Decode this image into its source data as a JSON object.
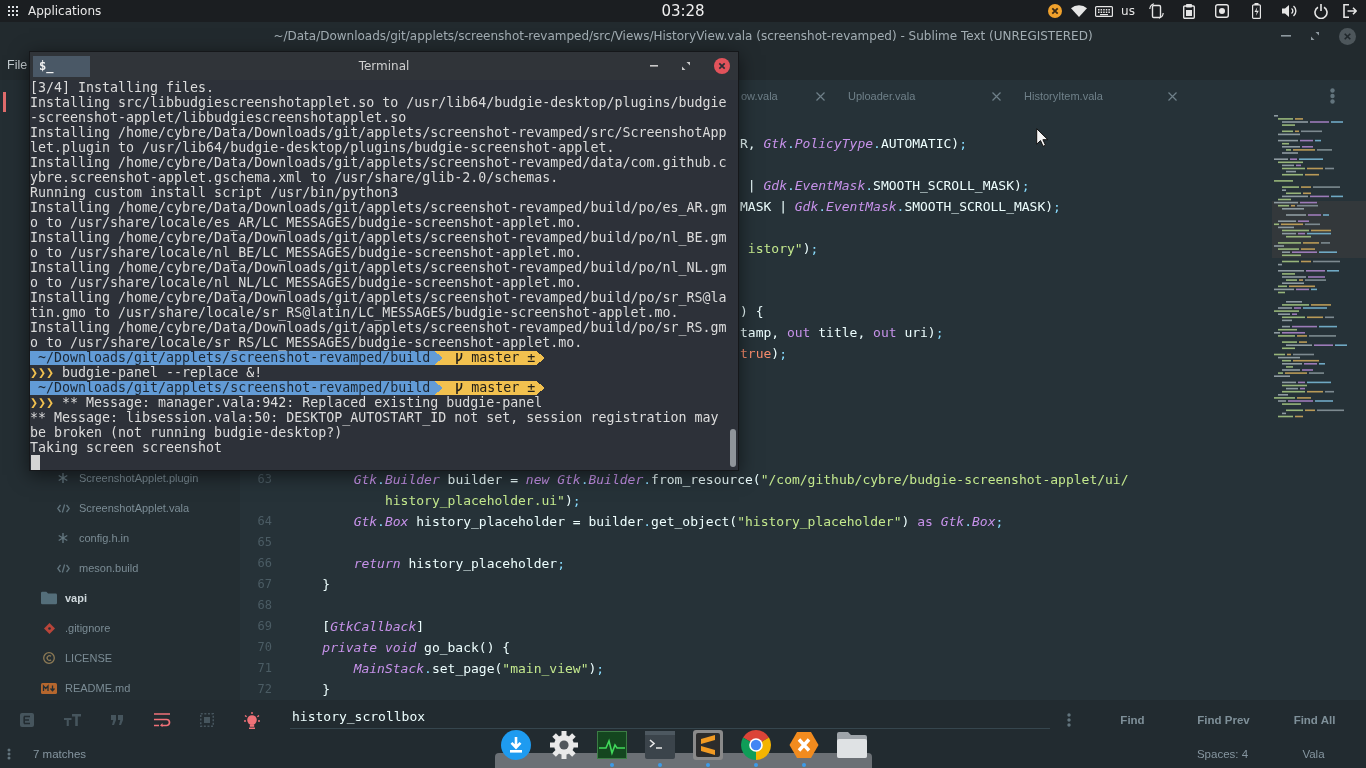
{
  "top_panel": {
    "menu": "Applications",
    "clock": "03:28",
    "keyboard_layout": "us"
  },
  "editor": {
    "title": "~/Data/Downloads/git/applets/screenshot-revamped/src/Views/HistoryView.vala (screenshot-revamped) - Sublime Text (UNREGISTERED)",
    "menu": [
      "File"
    ],
    "tabs": [
      {
        "label": "ow.vala",
        "selected": false
      },
      {
        "label": "Uploader.vala",
        "selected": false
      },
      {
        "label": "HistoryItem.vala",
        "selected": false
      }
    ],
    "sidebar": [
      {
        "children": [
          {
            "name": "ScreenshotApplet.plugin",
            "kind": "config"
          },
          {
            "name": "ScreenshotApplet.vala",
            "kind": "code"
          },
          {
            "name": "config.h.in",
            "kind": "config"
          },
          {
            "name": "meson.build",
            "kind": "code"
          }
        ]
      },
      {
        "name": "vapi",
        "kind": "folder"
      },
      {
        "name": ".gitignore",
        "kind": "git"
      },
      {
        "name": "LICENSE",
        "kind": "license"
      },
      {
        "name": "README.md",
        "kind": "markdown"
      }
    ],
    "fragments": [
      {
        "tokens": [
          {
            "kind": "plain",
            "text": "R, "
          },
          {
            "kind": "type",
            "text": "Gtk"
          },
          {
            "kind": "punct",
            "text": "."
          },
          {
            "kind": "type",
            "text": "PolicyType"
          },
          {
            "kind": "punct",
            "text": "."
          },
          {
            "kind": "plain",
            "text": "AUTOMATIC)"
          },
          {
            "kind": "punct",
            "text": ";"
          }
        ]
      },
      {
        "tokens": [
          {
            "kind": "plain",
            "text": " | "
          },
          {
            "kind": "type",
            "text": "Gdk"
          },
          {
            "kind": "punct",
            "text": "."
          },
          {
            "kind": "type",
            "text": "EventMask"
          },
          {
            "kind": "punct",
            "text": "."
          },
          {
            "kind": "plain",
            "text": "SMOOTH_SCROLL_MASK)"
          },
          {
            "kind": "punct",
            "text": ";"
          }
        ]
      },
      {
        "tokens": [
          {
            "kind": "plain",
            "text": "MASK | "
          },
          {
            "kind": "type",
            "text": "Gdk"
          },
          {
            "kind": "punct",
            "text": "."
          },
          {
            "kind": "type",
            "text": "EventMask"
          },
          {
            "kind": "punct",
            "text": "."
          },
          {
            "kind": "plain",
            "text": "SMOOTH_SCROLL_MASK)"
          },
          {
            "kind": "punct",
            "text": ";"
          }
        ]
      },
      {
        "tokens": [
          {
            "kind": "string",
            "text": " istory\""
          },
          {
            "kind": "plain",
            "text": ")"
          },
          {
            "kind": "punct",
            "text": ";"
          }
        ]
      },
      {
        "tokens": [
          {
            "kind": "plain",
            "text": ") {"
          }
        ]
      },
      {
        "tokens": [
          {
            "kind": "plain",
            "text": "tamp, "
          },
          {
            "kind": "keyword",
            "text": "out"
          },
          {
            "kind": "plain",
            "text": " title, "
          },
          {
            "kind": "keyword",
            "text": "out"
          },
          {
            "kind": "plain",
            "text": " uri)"
          },
          {
            "kind": "punct",
            "text": ";"
          }
        ]
      },
      {
        "tokens": [
          {
            "kind": "constant",
            "text": "true"
          },
          {
            "kind": "plain",
            "text": ")"
          },
          {
            "kind": "punct",
            "text": ";"
          }
        ]
      }
    ],
    "lines": [
      {
        "number": "63",
        "tokens": [
          {
            "kind": "type",
            "text": "        Gtk"
          },
          {
            "kind": "punct",
            "text": "."
          },
          {
            "kind": "type",
            "text": "Builder"
          },
          {
            "kind": "plain",
            "text": " builder = "
          },
          {
            "kind": "storage",
            "text": "new "
          },
          {
            "kind": "type",
            "text": "Gtk"
          },
          {
            "kind": "punct",
            "text": "."
          },
          {
            "kind": "type",
            "text": "Builder"
          },
          {
            "kind": "punct",
            "text": "."
          },
          {
            "kind": "plain",
            "text": "from_resource("
          },
          {
            "kind": "string",
            "text": "\"/com/github/cybre/budgie-screenshot-applet/ui/"
          }
        ],
        "continuation": [
          {
            "kind": "string",
            "text": "            history_placeholder.ui\""
          },
          {
            "kind": "plain",
            "text": ")"
          },
          {
            "kind": "punct",
            "text": ";"
          }
        ]
      },
      {
        "number": "64",
        "tokens": [
          {
            "kind": "type",
            "text": "        Gtk"
          },
          {
            "kind": "punct",
            "text": "."
          },
          {
            "kind": "type",
            "text": "Box"
          },
          {
            "kind": "plain",
            "text": " history_placeholder = builder"
          },
          {
            "kind": "punct",
            "text": "."
          },
          {
            "kind": "plain",
            "text": "get_object("
          },
          {
            "kind": "string",
            "text": "\"history_placeholder\""
          },
          {
            "kind": "plain",
            "text": ") "
          },
          {
            "kind": "keyword",
            "text": "as "
          },
          {
            "kind": "type",
            "text": "Gtk"
          },
          {
            "kind": "punct",
            "text": "."
          },
          {
            "kind": "type",
            "text": "Box"
          },
          {
            "kind": "punct",
            "text": ";"
          }
        ]
      },
      {
        "number": "65"
      },
      {
        "number": "66",
        "tokens": [
          {
            "kind": "storage",
            "text": "        return"
          },
          {
            "kind": "plain",
            "text": " history_placeholder"
          },
          {
            "kind": "punct",
            "text": ";"
          }
        ]
      },
      {
        "number": "67",
        "tokens": [
          {
            "kind": "plain",
            "text": "    }"
          }
        ]
      },
      {
        "number": "68"
      },
      {
        "number": "69",
        "tokens": [
          {
            "kind": "plain",
            "text": "    ["
          },
          {
            "kind": "type",
            "text": "GtkCallback"
          },
          {
            "kind": "plain",
            "text": "]"
          }
        ]
      },
      {
        "number": "70",
        "tokens": [
          {
            "kind": "storage",
            "text": "    private void"
          },
          {
            "kind": "plain",
            "text": " go_back() {"
          }
        ]
      },
      {
        "number": "71",
        "tokens": [
          {
            "kind": "type",
            "text": "        MainStack"
          },
          {
            "kind": "punct",
            "text": "."
          },
          {
            "kind": "plain",
            "text": "set_page("
          },
          {
            "kind": "string",
            "text": "\"main_view\""
          },
          {
            "kind": "plain",
            "text": ")"
          },
          {
            "kind": "punct",
            "text": ";"
          }
        ]
      },
      {
        "number": "72",
        "tokens": [
          {
            "kind": "plain",
            "text": "    }"
          }
        ]
      }
    ],
    "find": {
      "options": [
        {
          "kind": "regex",
          "on": false
        },
        {
          "kind": "case",
          "on": false
        },
        {
          "kind": "word",
          "on": false
        },
        {
          "kind": "wrap",
          "on": true
        },
        {
          "kind": "selection",
          "on": false
        },
        {
          "kind": "highlight",
          "on": true
        }
      ],
      "query": "history_scrollbox",
      "buttons": [
        "Find",
        "Find Prev",
        "Find All"
      ]
    },
    "status_bar": {
      "matches": "7 matches",
      "indentation": "Spaces: 4",
      "syntax": "Vala"
    }
  },
  "terminal": {
    "title": "Terminal",
    "badge": "$_",
    "lines": [
      {
        "kind": "output",
        "text": "[3/4] Installing files."
      },
      {
        "kind": "output",
        "text": "Installing src/libbudgiescreenshotapplet.so to /usr/lib64/budgie-desktop/plugins/budgie"
      },
      {
        "kind": "output",
        "text": "-screenshot-applet/libbudgiescreenshotapplet.so"
      },
      {
        "kind": "output",
        "text": "Installing /home/cybre/Data/Downloads/git/applets/screenshot-revamped/src/ScreenshotApp"
      },
      {
        "kind": "output",
        "text": "let.plugin to /usr/lib64/budgie-desktop/plugins/budgie-screenshot-applet."
      },
      {
        "kind": "output",
        "text": "Installing /home/cybre/Data/Downloads/git/applets/screenshot-revamped/data/com.github.c"
      },
      {
        "kind": "output",
        "text": "ybre.screenshot-applet.gschema.xml to /usr/share/glib-2.0/schemas."
      },
      {
        "kind": "output",
        "text": "Running custom install script /usr/bin/python3"
      },
      {
        "kind": "output",
        "text": "Installing /home/cybre/Data/Downloads/git/applets/screenshot-revamped/build/po/es_AR.gm"
      },
      {
        "kind": "output",
        "text": "o to /usr/share/locale/es_AR/LC_MESSAGES/budgie-screenshot-applet.mo."
      },
      {
        "kind": "output",
        "text": "Installing /home/cybre/Data/Downloads/git/applets/screenshot-revamped/build/po/nl_BE.gm"
      },
      {
        "kind": "output",
        "text": "o to /usr/share/locale/nl_BE/LC_MESSAGES/budgie-screenshot-applet.mo."
      },
      {
        "kind": "output",
        "text": "Installing /home/cybre/Data/Downloads/git/applets/screenshot-revamped/build/po/nl_NL.gm"
      },
      {
        "kind": "output",
        "text": "o to /usr/share/locale/nl_NL/LC_MESSAGES/budgie-screenshot-applet.mo."
      },
      {
        "kind": "output",
        "text": "Installing /home/cybre/Data/Downloads/git/applets/screenshot-revamped/build/po/sr_RS@la"
      },
      {
        "kind": "output",
        "text": "tin.gmo to /usr/share/locale/sr_RS@latin/LC_MESSAGES/budgie-screenshot-applet.mo."
      },
      {
        "kind": "output",
        "text": "Installing /home/cybre/Data/Downloads/git/applets/screenshot-revamped/build/po/sr_RS.gm"
      },
      {
        "kind": "output",
        "text": "o to /usr/share/locale/sr_RS/LC_MESSAGES/budgie-screenshot-applet.mo."
      },
      {
        "kind": "prompt",
        "path": "~/Downloads/git/applets/screenshot-revamped/build",
        "branch": "master ±"
      },
      {
        "kind": "command",
        "prompt": "❯❯❯",
        "text": "budgie-panel --replace &!"
      },
      {
        "kind": "prompt",
        "path": "~/Downloads/git/applets/screenshot-revamped/build",
        "branch": "master ±"
      },
      {
        "kind": "command",
        "prompt": "❯❯❯",
        "text": "** Message: manager.vala:942: Replaced existing budgie-panel"
      },
      {
        "kind": "output",
        "text": "** Message: libsession.vala:50: DESKTOP_AUTOSTART_ID not set, session registration may"
      },
      {
        "kind": "output",
        "text": "be broken (not running budgie-desktop?)"
      },
      {
        "kind": "output",
        "text": "Taking screen screenshot"
      }
    ]
  },
  "dock": [
    {
      "kind": "download",
      "running": false
    },
    {
      "kind": "settings",
      "running": false
    },
    {
      "kind": "monitor",
      "running": true
    },
    {
      "kind": "terminal",
      "running": true
    },
    {
      "kind": "editor",
      "running": true
    },
    {
      "kind": "browser",
      "running": true
    },
    {
      "kind": "hexagon",
      "running": true
    },
    {
      "kind": "files",
      "running": false
    }
  ]
}
